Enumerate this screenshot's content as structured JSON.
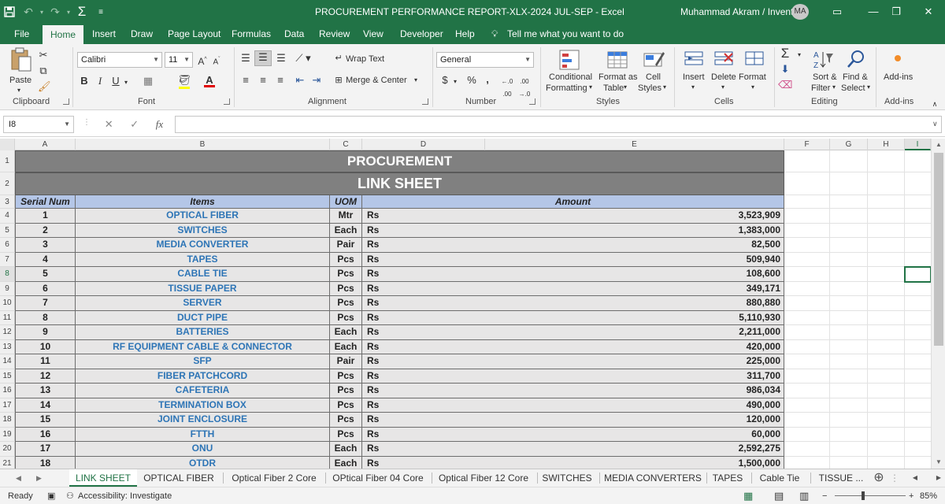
{
  "window": {
    "title": "PROCUREMENT PERFORMANCE REPORT-XLX-2024 JUL-SEP  -  Excel",
    "user": "Muhammad Akram / Inventory",
    "avatar_initials": "MA",
    "brand_color": "#217346"
  },
  "quick_access": [
    {
      "icon": "save-icon",
      "glyph": "🖫"
    },
    {
      "icon": "undo-icon",
      "glyph": "↶"
    },
    {
      "icon": "redo-icon",
      "glyph": "↷"
    },
    {
      "icon": "autosum-icon",
      "glyph": "Σ"
    },
    {
      "icon": "customize-qat-icon",
      "glyph": "≡"
    }
  ],
  "window_controls": [
    {
      "icon": "ribbon-display-icon",
      "glyph": "▭"
    },
    {
      "icon": "minimize-icon",
      "glyph": "—"
    },
    {
      "icon": "restore-icon",
      "glyph": "❐"
    },
    {
      "icon": "close-icon",
      "glyph": "✕"
    }
  ],
  "ribbon_tabs": [
    "File",
    "Home",
    "Insert",
    "Draw",
    "Page Layout",
    "Formulas",
    "Data",
    "Review",
    "View",
    "Developer",
    "Help"
  ],
  "active_tab": "Home",
  "tell_me": "Tell me what you want to do",
  "ribbon": {
    "clipboard": {
      "label": "Clipboard",
      "paste": "Paste"
    },
    "font": {
      "label": "Font",
      "name": "Calibri",
      "size": "11",
      "bold": "B",
      "italic": "I",
      "underline": "U"
    },
    "alignment": {
      "label": "Alignment",
      "wrap_text": "Wrap Text",
      "merge_center": "Merge & Center"
    },
    "number": {
      "label": "Number",
      "format": "General",
      "currency": "$",
      "percent": "%",
      "comma": ","
    },
    "styles": {
      "label": "Styles",
      "conditional": [
        "Conditional",
        "Formatting"
      ],
      "format_as": [
        "Format as",
        "Table"
      ],
      "cell_styles": [
        "Cell",
        "Styles"
      ]
    },
    "cells": {
      "label": "Cells",
      "insert": "Insert",
      "delete": "Delete",
      "format": "Format"
    },
    "editing": {
      "label": "Editing",
      "sort": [
        "Sort &",
        "Filter"
      ],
      "find": [
        "Find &",
        "Select"
      ]
    },
    "addins": {
      "label": "Add-ins",
      "button": "Add-ins"
    }
  },
  "formula_bar": {
    "name_box": "I8",
    "formula": "",
    "fx": "fx"
  },
  "columns": [
    "A",
    "B",
    "C",
    "D",
    "E",
    "F",
    "G",
    "H",
    "I"
  ],
  "sheet": {
    "title1": "PROCUREMENT",
    "title2": "LINK SHEET",
    "headers": {
      "serial": "Serial Num",
      "items": "Items",
      "uom": "UOM",
      "amount": "Amount"
    },
    "rows": [
      {
        "n": "1",
        "item": "OPTICAL FIBER",
        "uom": "Mtr",
        "cur": "Rs",
        "amount": "3,523,909"
      },
      {
        "n": "2",
        "item": "SWITCHES",
        "uom": "Each",
        "cur": "Rs",
        "amount": "1,383,000"
      },
      {
        "n": "3",
        "item": "MEDIA CONVERTER",
        "uom": "Pair",
        "cur": "Rs",
        "amount": "82,500"
      },
      {
        "n": "4",
        "item": "TAPES",
        "uom": "Pcs",
        "cur": "Rs",
        "amount": "509,940"
      },
      {
        "n": "5",
        "item": "CABLE TIE",
        "uom": "Pcs",
        "cur": "Rs",
        "amount": "108,600"
      },
      {
        "n": "6",
        "item": "TISSUE PAPER",
        "uom": "Pcs",
        "cur": "Rs",
        "amount": "349,171"
      },
      {
        "n": "7",
        "item": "SERVER",
        "uom": "Pcs",
        "cur": "Rs",
        "amount": "880,880"
      },
      {
        "n": "8",
        "item": "DUCT PIPE",
        "uom": "Pcs",
        "cur": "Rs",
        "amount": "5,110,930"
      },
      {
        "n": "9",
        "item": "BATTERIES",
        "uom": "Each",
        "cur": "Rs",
        "amount": "2,211,000"
      },
      {
        "n": "10",
        "item": "RF EQUIPMENT CABLE & CONNECTOR",
        "uom": "Each",
        "cur": "Rs",
        "amount": "420,000"
      },
      {
        "n": "11",
        "item": "SFP",
        "uom": "Pair",
        "cur": "Rs",
        "amount": "225,000"
      },
      {
        "n": "12",
        "item": "FIBER PATCHCORD",
        "uom": "Pcs",
        "cur": "Rs",
        "amount": "311,700"
      },
      {
        "n": "13",
        "item": "CAFETERIA",
        "uom": "Pcs",
        "cur": "Rs",
        "amount": "986,034"
      },
      {
        "n": "14",
        "item": "TERMINATION BOX",
        "uom": "Pcs",
        "cur": "Rs",
        "amount": "490,000"
      },
      {
        "n": "15",
        "item": "JOINT ENCLOSURE",
        "uom": "Pcs",
        "cur": "Rs",
        "amount": "120,000"
      },
      {
        "n": "16",
        "item": "FTTH",
        "uom": "Pcs",
        "cur": "Rs",
        "amount": "60,000"
      },
      {
        "n": "17",
        "item": "ONU",
        "uom": "Each",
        "cur": "Rs",
        "amount": "2,592,275"
      },
      {
        "n": "18",
        "item": "OTDR",
        "uom": "Each",
        "cur": "Rs",
        "amount": "1,500,000"
      }
    ]
  },
  "sheet_tabs": [
    "LINK SHEET",
    "OPTICAL FIBER",
    "Optical Fiber 2 Core",
    "OPtical Fiber 04 Core",
    "Optical Fiber 12 Core",
    "SWITCHES",
    "MEDIA CONVERTERS",
    "TAPES",
    "Cable Tie",
    "TISSUE ..."
  ],
  "active_sheet": "LINK SHEET",
  "status": {
    "ready": "Ready",
    "accessibility": "Accessibility: Investigate",
    "zoom": "85%"
  }
}
